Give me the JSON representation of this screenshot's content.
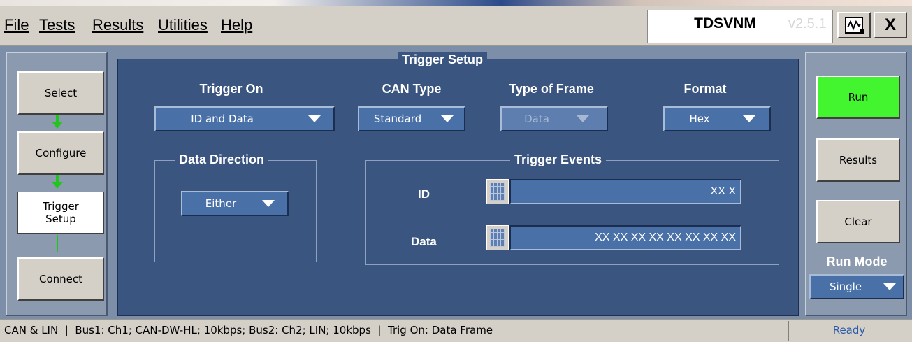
{
  "menu": {
    "items": [
      {
        "label": "File"
      },
      {
        "label": "Tests"
      },
      {
        "label": "Results"
      },
      {
        "label": "Utilities"
      },
      {
        "label": "Help"
      }
    ],
    "app_name": "TDSVNM",
    "app_name_faded": "v2.5.1",
    "minimize_icon": "waveform-icon",
    "close_label": "X"
  },
  "nav": {
    "items": [
      {
        "label": "Select"
      },
      {
        "label": "Configure"
      },
      {
        "label": "Trigger\nSetup"
      },
      {
        "label": "Connect"
      }
    ]
  },
  "trigger_setup": {
    "title": "Trigger Setup",
    "trigger_on": {
      "label": "Trigger On",
      "value": "ID and Data"
    },
    "can_type": {
      "label": "CAN Type",
      "value": "Standard"
    },
    "type_of_frame": {
      "label": "Type of Frame",
      "value": "Data"
    },
    "format": {
      "label": "Format",
      "value": "Hex"
    },
    "data_direction": {
      "title": "Data Direction",
      "value": "Either"
    },
    "trigger_events": {
      "title": "Trigger Events",
      "id_label": "ID",
      "id_value": "XX X",
      "data_label": "Data",
      "data_value": "XX XX XX XX XX XX XX XX"
    }
  },
  "right": {
    "run": "Run",
    "results": "Results",
    "clear": "Clear",
    "run_mode_label": "Run Mode",
    "run_mode_value": "Single"
  },
  "status": {
    "text": "CAN & LIN  |  Bus1: Ch1; CAN-DW-HL; 10kbps; Bus2: Ch2; LIN; 10kbps  |  Trig On: Data Frame",
    "ready": "Ready"
  },
  "colors": {
    "run_button": "#43f52f",
    "panel_bg": "#3a5580",
    "nav_arrow": "#22c51a"
  }
}
